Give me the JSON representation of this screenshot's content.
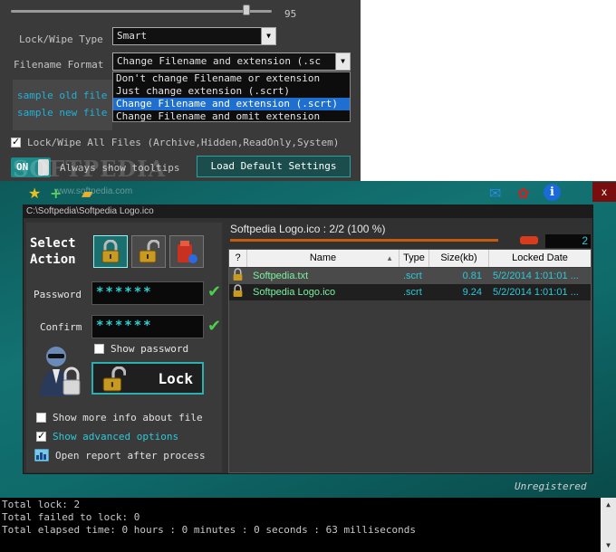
{
  "settings": {
    "slider_value": "95",
    "slider_level": 0.95,
    "lock_wipe_type_label": "Lock/Wipe Type",
    "lock_wipe_type_value": "Smart",
    "filename_format_label": "Filename Format",
    "filename_format_value": "Change Filename and extension (.sc",
    "filename_format_options": [
      "Don't change Filename or extension",
      "Just change extension (.scrt)",
      "Change Filename and extension (.scrt)",
      "Change Filename and omit extension"
    ],
    "filename_format_selected_index": 2,
    "sample_old_label": "sample old file",
    "sample_new_label": "sample new file",
    "lock_all_files_label": "Lock/Wipe All Files (Archive,Hidden,ReadOnly,System)",
    "lock_all_files_checked": true,
    "toggle_label": "ON",
    "tooltips_label": "Always show tooltips",
    "load_default_label": "Load Default Settings",
    "watermark": "SOFTPEDIA",
    "watermark_url": "www.softpedia.com"
  },
  "window": {
    "close_label": "x",
    "icons": [
      "star-icon",
      "add-icon",
      "folder-icon",
      "mail-icon",
      "award-icon",
      "info-icon"
    ],
    "path": "C:\\Softpedia\\Softpedia Logo.ico",
    "unregistered_label": "Unregistered"
  },
  "action": {
    "select_action_label": "Select Action",
    "buttons": [
      "lock-action-icon",
      "unlock-action-icon",
      "wipe-action-icon"
    ],
    "password_label": "Password",
    "password_value": "******",
    "confirm_label": "Confirm",
    "confirm_value": "******",
    "show_password_label": "Show password",
    "show_password_checked": false,
    "lock_button_label": "Lock",
    "options": [
      {
        "label": "Show more info about file",
        "checked": false
      },
      {
        "label": "Show advanced options",
        "checked": true
      },
      {
        "label": "Open report after process",
        "checked": null
      }
    ]
  },
  "files": {
    "status": "Softpedia Logo.ico : 2/2 (100 %)",
    "progress": 1.0,
    "count": "2",
    "columns": [
      "?",
      "Name",
      "Type",
      "Size(kb)",
      "Locked Date"
    ],
    "rows": [
      {
        "name": "Softpedia.txt",
        "type": ".scrt",
        "size": "0.81",
        "date": "5/2/2014 1:01:01 ..."
      },
      {
        "name": "Softpedia Logo.ico",
        "type": ".scrt",
        "size": "9.24",
        "date": "5/2/2014 1:01:01 ..."
      }
    ]
  },
  "console": {
    "lines": [
      "Total lock: 2",
      "Total failed to lock: 0",
      "Total elapsed time: 0 hours : 0 minutes : 0 seconds : 63 milliseconds"
    ]
  },
  "colors": {
    "accent_teal": "#137272",
    "highlight_blue": "#1e6fd0",
    "file_text": "#2ec8d8",
    "ok_green": "#4ccf4c"
  }
}
